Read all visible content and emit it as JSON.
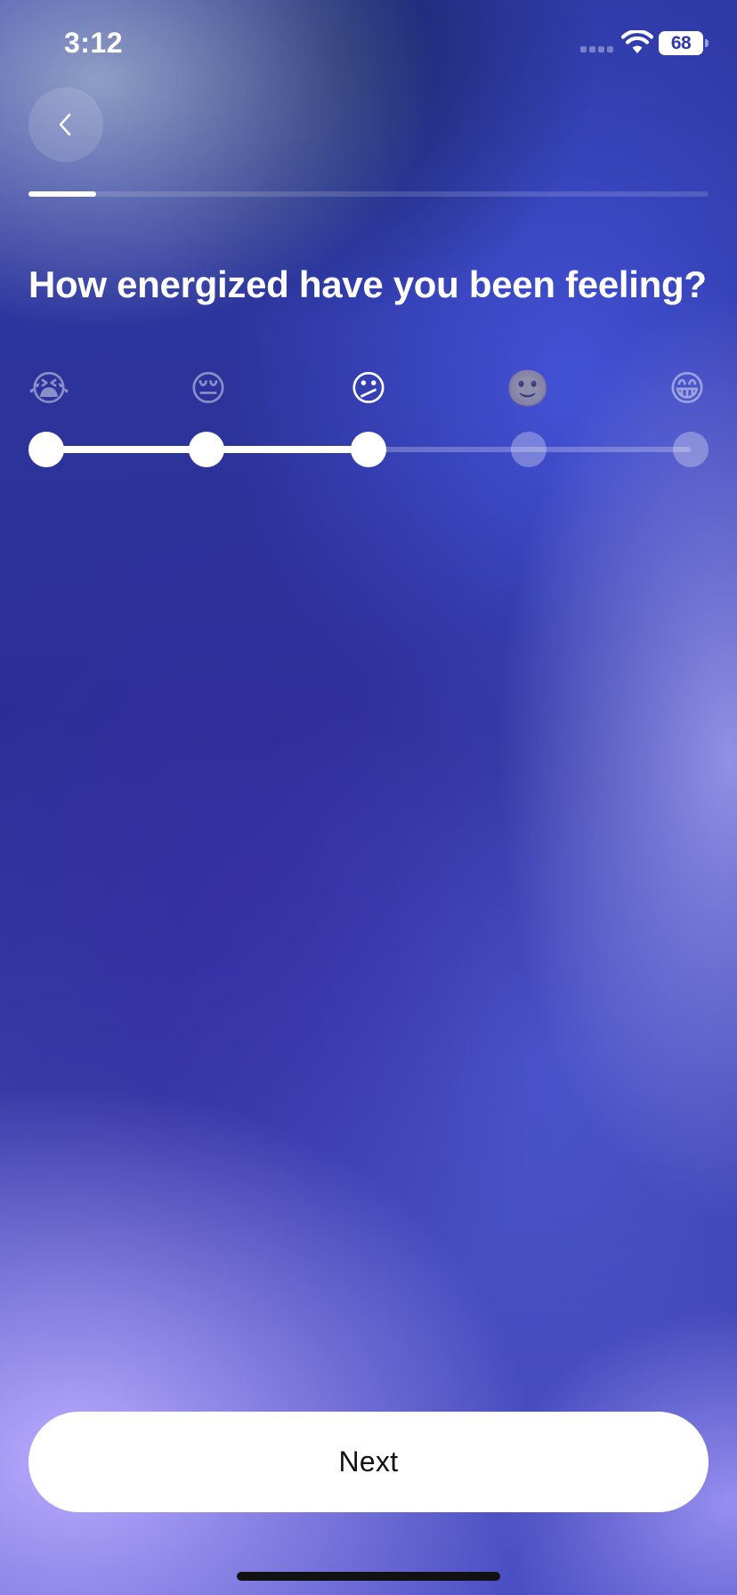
{
  "status_bar": {
    "time": "3:12",
    "battery_level": "68",
    "signal_icon": "cellular-signal-icon",
    "wifi_icon": "wifi-icon",
    "battery_icon": "battery-icon"
  },
  "header": {
    "back_icon": "chevron-left-icon",
    "progress_fraction": 0.1
  },
  "question": {
    "title": "How energized have you been feeling?"
  },
  "scale": {
    "options": [
      {
        "emoji": "😭",
        "icon": "loudly-crying-face-icon"
      },
      {
        "emoji": "😔",
        "icon": "pensive-face-icon"
      },
      {
        "emoji": "😕",
        "icon": "confused-face-icon"
      },
      {
        "emoji": "🙂",
        "icon": "slightly-smiling-face-icon"
      },
      {
        "emoji": "😁",
        "icon": "grinning-face-icon"
      }
    ],
    "selected_index": 2
  },
  "footer": {
    "next_label": "Next"
  },
  "colors": {
    "accent": "#ffffff",
    "background_top": "#2e3aa6",
    "background_bottom": "#b9aaff"
  }
}
